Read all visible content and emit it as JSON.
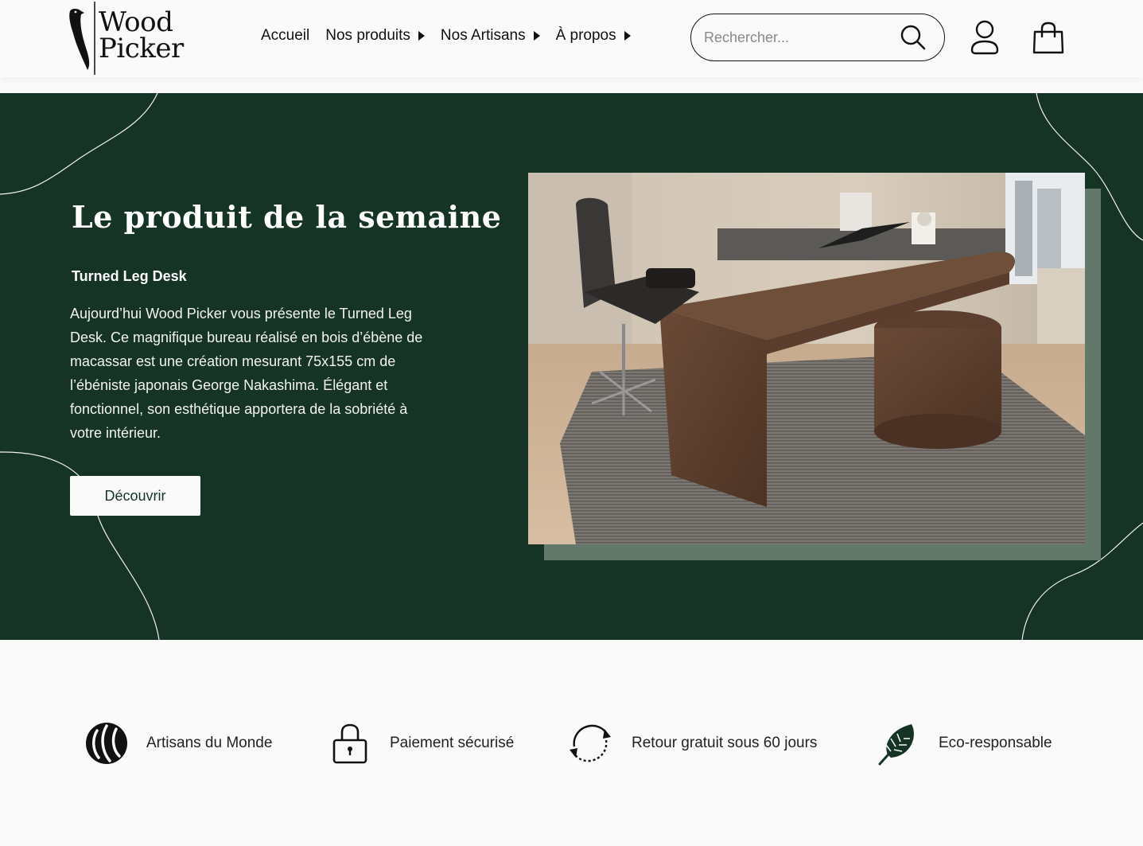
{
  "brand": {
    "line1": "Wood",
    "line2": "Picker"
  },
  "nav": {
    "items": [
      {
        "label": "Accueil",
        "has_caret": false
      },
      {
        "label": "Nos produits",
        "has_caret": true
      },
      {
        "label": "Nos Artisans",
        "has_caret": true
      },
      {
        "label": "À propos",
        "has_caret": true
      }
    ]
  },
  "search": {
    "placeholder": "Rechercher...",
    "value": ""
  },
  "hero": {
    "title": "Le produit de la semaine",
    "product_name": "Turned Leg Desk",
    "description": "Aujourd’hui Wood Picker vous présente le Turned Leg Desk. Ce magnifique bureau réalisé en bois d’ébène de macassar est une création mesurant 75x155 cm de l’ébéniste japonais George Nakashima. Élégant et fonctionnel, son esthétique apportera de la sobriété à votre intérieur.",
    "button_label": "Découvrir"
  },
  "features": [
    {
      "label": "Artisans du Monde",
      "icon": "globe-wood-icon"
    },
    {
      "label": "Paiement sécurisé",
      "icon": "lock-icon"
    },
    {
      "label": "Retour gratuit sous 60 jours",
      "icon": "refresh-icon"
    },
    {
      "label": "Eco-responsable",
      "icon": "leaf-icon"
    }
  ],
  "colors": {
    "hero_bg": "#163426",
    "accent_shadow": "#62786a",
    "page_bg": "#fafafa",
    "text": "#1a1a1a"
  }
}
